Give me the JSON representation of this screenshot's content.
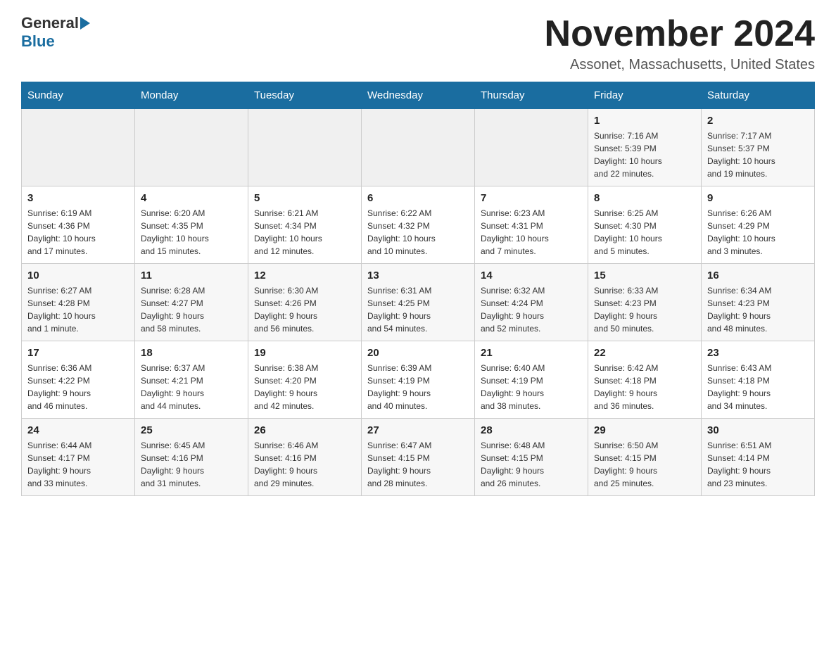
{
  "header": {
    "logo_general": "General",
    "logo_blue": "Blue",
    "month_title": "November 2024",
    "location": "Assonet, Massachusetts, United States"
  },
  "days_of_week": [
    "Sunday",
    "Monday",
    "Tuesday",
    "Wednesday",
    "Thursday",
    "Friday",
    "Saturday"
  ],
  "weeks": [
    [
      {
        "day": "",
        "info": ""
      },
      {
        "day": "",
        "info": ""
      },
      {
        "day": "",
        "info": ""
      },
      {
        "day": "",
        "info": ""
      },
      {
        "day": "",
        "info": ""
      },
      {
        "day": "1",
        "info": "Sunrise: 7:16 AM\nSunset: 5:39 PM\nDaylight: 10 hours\nand 22 minutes."
      },
      {
        "day": "2",
        "info": "Sunrise: 7:17 AM\nSunset: 5:37 PM\nDaylight: 10 hours\nand 19 minutes."
      }
    ],
    [
      {
        "day": "3",
        "info": "Sunrise: 6:19 AM\nSunset: 4:36 PM\nDaylight: 10 hours\nand 17 minutes."
      },
      {
        "day": "4",
        "info": "Sunrise: 6:20 AM\nSunset: 4:35 PM\nDaylight: 10 hours\nand 15 minutes."
      },
      {
        "day": "5",
        "info": "Sunrise: 6:21 AM\nSunset: 4:34 PM\nDaylight: 10 hours\nand 12 minutes."
      },
      {
        "day": "6",
        "info": "Sunrise: 6:22 AM\nSunset: 4:32 PM\nDaylight: 10 hours\nand 10 minutes."
      },
      {
        "day": "7",
        "info": "Sunrise: 6:23 AM\nSunset: 4:31 PM\nDaylight: 10 hours\nand 7 minutes."
      },
      {
        "day": "8",
        "info": "Sunrise: 6:25 AM\nSunset: 4:30 PM\nDaylight: 10 hours\nand 5 minutes."
      },
      {
        "day": "9",
        "info": "Sunrise: 6:26 AM\nSunset: 4:29 PM\nDaylight: 10 hours\nand 3 minutes."
      }
    ],
    [
      {
        "day": "10",
        "info": "Sunrise: 6:27 AM\nSunset: 4:28 PM\nDaylight: 10 hours\nand 1 minute."
      },
      {
        "day": "11",
        "info": "Sunrise: 6:28 AM\nSunset: 4:27 PM\nDaylight: 9 hours\nand 58 minutes."
      },
      {
        "day": "12",
        "info": "Sunrise: 6:30 AM\nSunset: 4:26 PM\nDaylight: 9 hours\nand 56 minutes."
      },
      {
        "day": "13",
        "info": "Sunrise: 6:31 AM\nSunset: 4:25 PM\nDaylight: 9 hours\nand 54 minutes."
      },
      {
        "day": "14",
        "info": "Sunrise: 6:32 AM\nSunset: 4:24 PM\nDaylight: 9 hours\nand 52 minutes."
      },
      {
        "day": "15",
        "info": "Sunrise: 6:33 AM\nSunset: 4:23 PM\nDaylight: 9 hours\nand 50 minutes."
      },
      {
        "day": "16",
        "info": "Sunrise: 6:34 AM\nSunset: 4:23 PM\nDaylight: 9 hours\nand 48 minutes."
      }
    ],
    [
      {
        "day": "17",
        "info": "Sunrise: 6:36 AM\nSunset: 4:22 PM\nDaylight: 9 hours\nand 46 minutes."
      },
      {
        "day": "18",
        "info": "Sunrise: 6:37 AM\nSunset: 4:21 PM\nDaylight: 9 hours\nand 44 minutes."
      },
      {
        "day": "19",
        "info": "Sunrise: 6:38 AM\nSunset: 4:20 PM\nDaylight: 9 hours\nand 42 minutes."
      },
      {
        "day": "20",
        "info": "Sunrise: 6:39 AM\nSunset: 4:19 PM\nDaylight: 9 hours\nand 40 minutes."
      },
      {
        "day": "21",
        "info": "Sunrise: 6:40 AM\nSunset: 4:19 PM\nDaylight: 9 hours\nand 38 minutes."
      },
      {
        "day": "22",
        "info": "Sunrise: 6:42 AM\nSunset: 4:18 PM\nDaylight: 9 hours\nand 36 minutes."
      },
      {
        "day": "23",
        "info": "Sunrise: 6:43 AM\nSunset: 4:18 PM\nDaylight: 9 hours\nand 34 minutes."
      }
    ],
    [
      {
        "day": "24",
        "info": "Sunrise: 6:44 AM\nSunset: 4:17 PM\nDaylight: 9 hours\nand 33 minutes."
      },
      {
        "day": "25",
        "info": "Sunrise: 6:45 AM\nSunset: 4:16 PM\nDaylight: 9 hours\nand 31 minutes."
      },
      {
        "day": "26",
        "info": "Sunrise: 6:46 AM\nSunset: 4:16 PM\nDaylight: 9 hours\nand 29 minutes."
      },
      {
        "day": "27",
        "info": "Sunrise: 6:47 AM\nSunset: 4:15 PM\nDaylight: 9 hours\nand 28 minutes."
      },
      {
        "day": "28",
        "info": "Sunrise: 6:48 AM\nSunset: 4:15 PM\nDaylight: 9 hours\nand 26 minutes."
      },
      {
        "day": "29",
        "info": "Sunrise: 6:50 AM\nSunset: 4:15 PM\nDaylight: 9 hours\nand 25 minutes."
      },
      {
        "day": "30",
        "info": "Sunrise: 6:51 AM\nSunset: 4:14 PM\nDaylight: 9 hours\nand 23 minutes."
      }
    ]
  ]
}
